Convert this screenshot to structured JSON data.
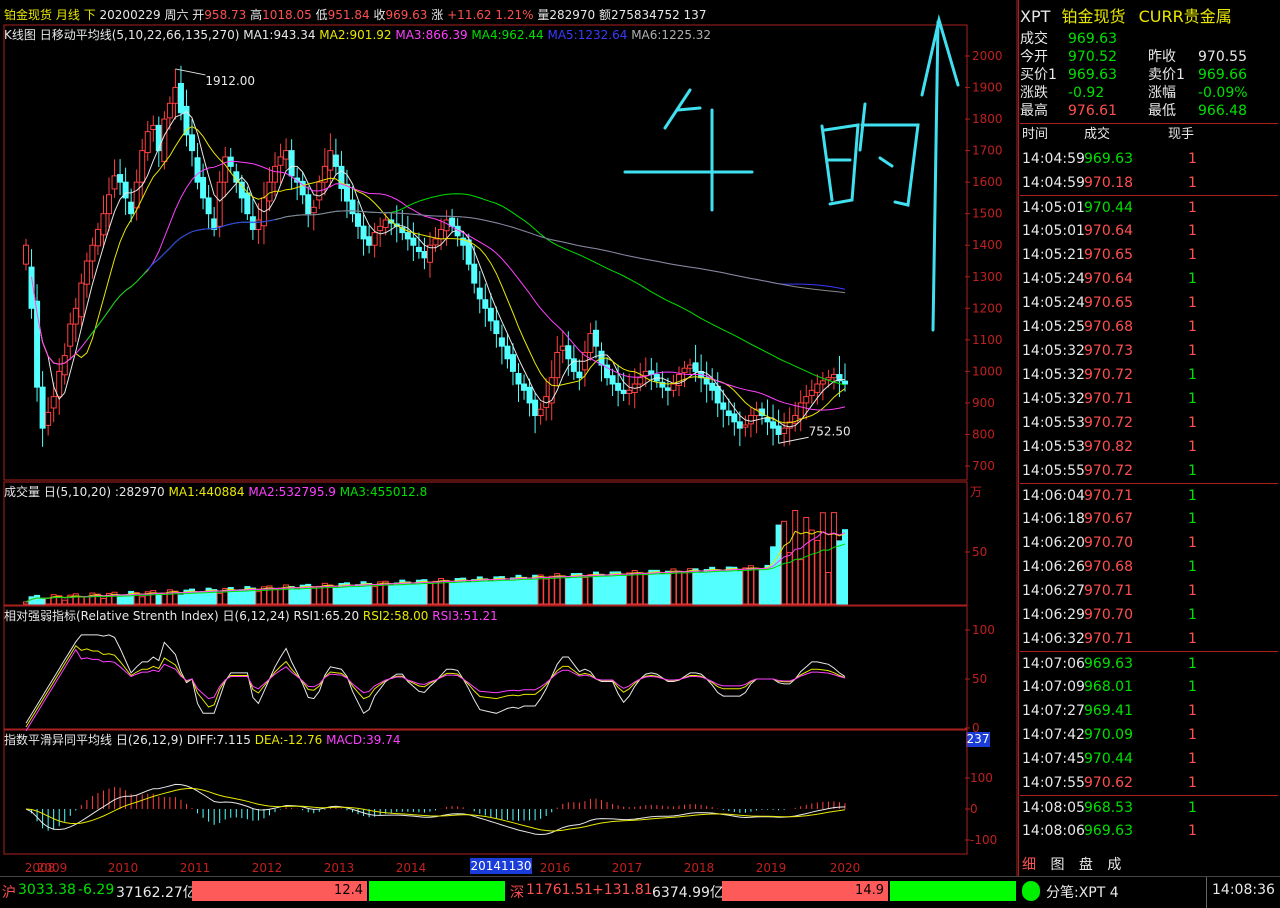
{
  "header": {
    "name": "铂金现货",
    "period": "月线",
    "dir": "下",
    "date": "20200229",
    "weekday": "周六",
    "open_label": "开",
    "open": "958.73",
    "high_label": "高",
    "high": "1018.05",
    "low_label": "低",
    "low": "951.84",
    "close_label": "收",
    "close": "969.63",
    "chg_label": "涨",
    "chg": "+11.62",
    "chg_pct": "1.21%",
    "vol_label": "量",
    "vol": "282970",
    "amt_label": "额",
    "amt": "275834752",
    "extra": "137"
  },
  "ma_line": {
    "prefix": "K线图 ",
    "box_glyph": "日",
    "name": "移动平均线",
    "params": "(5,10,22,66,135,270)",
    "ma1": "MA1:943.34",
    "ma2": "MA2:901.92",
    "ma3": "MA3:866.39",
    "ma4": "MA4:962.44",
    "ma5": "MA5:1232.64",
    "ma6": "MA6:1225.32"
  },
  "vol_line": {
    "prefix": "成交量 ",
    "params": "(5,10,20) :282970",
    "ma1": "MA1:440884",
    "ma2": "MA2:532795.9",
    "ma3": "MA3:455012.8",
    "unit": "万"
  },
  "rsi_line": {
    "prefix": "相对强弱指标(Relative Strenth Index) ",
    "params": "(6,12,24)",
    "rsi1": "RSI1:65.20",
    "rsi2": "RSI2:58.00",
    "rsi3": "RSI3:51.21"
  },
  "macd_line": {
    "prefix": "指数平滑异同平均线 ",
    "params": "(26,12,9)",
    "diff": "DIFF:7.115",
    "dea": "DEA:-12.76",
    "macd": "MACD:39.74",
    "badge": "237"
  },
  "price_annotations": {
    "high_label": "1912.00",
    "low_label": "752.50"
  },
  "cursor_date": "20141130",
  "handwriting": "牛 的",
  "quote": {
    "symbol": "XPT",
    "name": "铂金现货",
    "market": "CURR贵金属",
    "rows": [
      {
        "l1": "成交",
        "v1": "969.63",
        "c1": "grn",
        "l2": "",
        "v2": "",
        "c2": ""
      },
      {
        "l1": "今开",
        "v1": "970.52",
        "c1": "grn",
        "l2": "昨收",
        "v2": "970.55",
        "c2": "wht"
      },
      {
        "l1": "买价1",
        "v1": "969.63",
        "c1": "grn",
        "l2": "卖价1",
        "v2": "969.66",
        "c2": "grn"
      },
      {
        "l1": "涨跌",
        "v1": "-0.92",
        "c1": "grn",
        "l2": "涨幅",
        "v2": "-0.09%",
        "c2": "grn"
      },
      {
        "l1": "最高",
        "v1": "976.61",
        "c1": "red",
        "l2": "最低",
        "v2": "966.48",
        "c2": "grn"
      }
    ],
    "tick_headers": [
      "时间",
      "成交",
      "现手"
    ],
    "ticks": [
      {
        "t": "14:04:59",
        "p": "969.63",
        "c": "grn",
        "q": "1",
        "qc": "red"
      },
      {
        "t": "14:04:59",
        "p": "970.18",
        "c": "red",
        "q": "1",
        "qc": "red"
      },
      {
        "t": "14:05:01",
        "p": "970.44",
        "c": "grn",
        "q": "1",
        "qc": "red"
      },
      {
        "t": "14:05:01",
        "p": "970.64",
        "c": "red",
        "q": "1",
        "qc": "red"
      },
      {
        "t": "14:05:21",
        "p": "970.65",
        "c": "red",
        "q": "1",
        "qc": "red"
      },
      {
        "t": "14:05:24",
        "p": "970.64",
        "c": "red",
        "q": "1",
        "qc": "grn"
      },
      {
        "t": "14:05:24",
        "p": "970.65",
        "c": "red",
        "q": "1",
        "qc": "red"
      },
      {
        "t": "14:05:25",
        "p": "970.68",
        "c": "red",
        "q": "1",
        "qc": "red"
      },
      {
        "t": "14:05:32",
        "p": "970.73",
        "c": "red",
        "q": "1",
        "qc": "red"
      },
      {
        "t": "14:05:32",
        "p": "970.72",
        "c": "red",
        "q": "1",
        "qc": "grn"
      },
      {
        "t": "14:05:32",
        "p": "970.71",
        "c": "red",
        "q": "1",
        "qc": "grn"
      },
      {
        "t": "14:05:53",
        "p": "970.72",
        "c": "red",
        "q": "1",
        "qc": "red"
      },
      {
        "t": "14:05:53",
        "p": "970.82",
        "c": "red",
        "q": "1",
        "qc": "red"
      },
      {
        "t": "14:05:55",
        "p": "970.72",
        "c": "red",
        "q": "1",
        "qc": "grn"
      },
      {
        "t": "14:06:04",
        "p": "970.71",
        "c": "red",
        "q": "1",
        "qc": "grn"
      },
      {
        "t": "14:06:18",
        "p": "970.67",
        "c": "red",
        "q": "1",
        "qc": "grn"
      },
      {
        "t": "14:06:20",
        "p": "970.70",
        "c": "red",
        "q": "1",
        "qc": "red"
      },
      {
        "t": "14:06:26",
        "p": "970.68",
        "c": "red",
        "q": "1",
        "qc": "grn"
      },
      {
        "t": "14:06:27",
        "p": "970.71",
        "c": "red",
        "q": "1",
        "qc": "red"
      },
      {
        "t": "14:06:29",
        "p": "970.70",
        "c": "red",
        "q": "1",
        "qc": "grn"
      },
      {
        "t": "14:06:32",
        "p": "970.71",
        "c": "red",
        "q": "1",
        "qc": "red"
      },
      {
        "t": "14:07:06",
        "p": "969.63",
        "c": "grn",
        "q": "1",
        "qc": "grn"
      },
      {
        "t": "14:07:09",
        "p": "968.01",
        "c": "grn",
        "q": "1",
        "qc": "grn"
      },
      {
        "t": "14:07:27",
        "p": "969.41",
        "c": "grn",
        "q": "1",
        "qc": "red"
      },
      {
        "t": "14:07:42",
        "p": "970.09",
        "c": "grn",
        "q": "1",
        "qc": "red"
      },
      {
        "t": "14:07:45",
        "p": "970.44",
        "c": "grn",
        "q": "1",
        "qc": "red"
      },
      {
        "t": "14:07:55",
        "p": "970.62",
        "c": "red",
        "q": "1",
        "qc": "red"
      },
      {
        "t": "14:08:05",
        "p": "968.53",
        "c": "grn",
        "q": "1",
        "qc": "grn"
      },
      {
        "t": "14:08:06",
        "p": "969.63",
        "c": "grn",
        "q": "1",
        "qc": "red"
      }
    ],
    "tabs": [
      "细",
      "图",
      "盘",
      "成"
    ]
  },
  "status_bar": {
    "sh_label": "沪",
    "sh_value": "3033.38",
    "sh_chg": "-6.29",
    "sh_amt": "37162.27亿",
    "sh_bar": "12.4",
    "sz_label": "深",
    "sz_value": "11761.51",
    "sz_chg": "+131.81",
    "sz_amt": "6374.99亿",
    "sz_bar": "14.9",
    "fenbi": "分笔:XPT 4",
    "time": "14:08:36"
  },
  "chart_data": [
    {
      "type": "candlestick",
      "panel": "price",
      "x_tick_labels": [
        "2008",
        "2009",
        "2010",
        "2011",
        "2012",
        "2013",
        "2014",
        "2016",
        "2017",
        "2018",
        "2019",
        "2020"
      ],
      "y_ticks": [
        700,
        800,
        900,
        1000,
        1100,
        1200,
        1300,
        1400,
        1500,
        1600,
        1700,
        1800,
        1900,
        2000
      ],
      "ylim": [
        680,
        2040
      ],
      "close_approx": [
        1400,
        1200,
        950,
        820,
        870,
        920,
        1000,
        1050,
        1150,
        1200,
        1280,
        1350,
        1400,
        1450,
        1500,
        1560,
        1620,
        1600,
        1550,
        1500,
        1600,
        1700,
        1760,
        1780,
        1700,
        1800,
        1850,
        1900,
        1820,
        1750,
        1700,
        1600,
        1550,
        1500,
        1450,
        1600,
        1680,
        1650,
        1600,
        1550,
        1500,
        1450,
        1480,
        1550,
        1600,
        1650,
        1680,
        1700,
        1620,
        1600,
        1560,
        1500,
        1520,
        1600,
        1650,
        1700,
        1650,
        1580,
        1540,
        1500,
        1460,
        1420,
        1400,
        1440,
        1460,
        1480,
        1470,
        1460,
        1440,
        1420,
        1400,
        1380,
        1360,
        1400,
        1420,
        1450,
        1480,
        1460,
        1430,
        1400,
        1340,
        1280,
        1230,
        1200,
        1160,
        1120,
        1080,
        1040,
        1000,
        960,
        940,
        900,
        860,
        880,
        920,
        980,
        1060,
        1080,
        1040,
        1000,
        980,
        1060,
        1120,
        1080,
        1020,
        980,
        960,
        940,
        930,
        940,
        960,
        980,
        1000,
        990,
        970,
        950,
        940,
        960,
        990,
        1010,
        1020,
        1000,
        980,
        960,
        940,
        900,
        880,
        860,
        840,
        820,
        830,
        860,
        880,
        860,
        840,
        820,
        800,
        820,
        840,
        860,
        900,
        920,
        940,
        960,
        970,
        980,
        990,
        970,
        960
      ],
      "ma_labels": [
        "MA1:943.34",
        "MA2:901.92",
        "MA3:866.39",
        "MA4:962.44",
        "MA5:1232.64",
        "MA6:1225.32"
      ],
      "ma_colors": [
        "#e8e8e8",
        "#e8e800",
        "#ff40ff",
        "#00e000",
        "#3a3aff",
        "#888888"
      ],
      "annotations": [
        {
          "text": "1912.00"
        },
        {
          "text": "752.50"
        }
      ]
    },
    {
      "type": "bar",
      "panel": "volume",
      "unit": "万",
      "y_ticks": [
        50
      ],
      "ylim": [
        0,
        100
      ]
    },
    {
      "type": "line",
      "panel": "rsi",
      "y_ticks": [
        0,
        50,
        100
      ],
      "ylim": [
        0,
        100
      ],
      "series_names": [
        "RSI1",
        "RSI2",
        "RSI3"
      ],
      "last_values": [
        65.2,
        58.0,
        51.21
      ]
    },
    {
      "type": "bar",
      "panel": "macd",
      "y_ticks": [
        100,
        0,
        -100
      ],
      "ylim": [
        -130,
        180
      ],
      "last_values": {
        "DIFF": 7.115,
        "DEA": -12.76,
        "MACD": 39.74
      }
    }
  ]
}
